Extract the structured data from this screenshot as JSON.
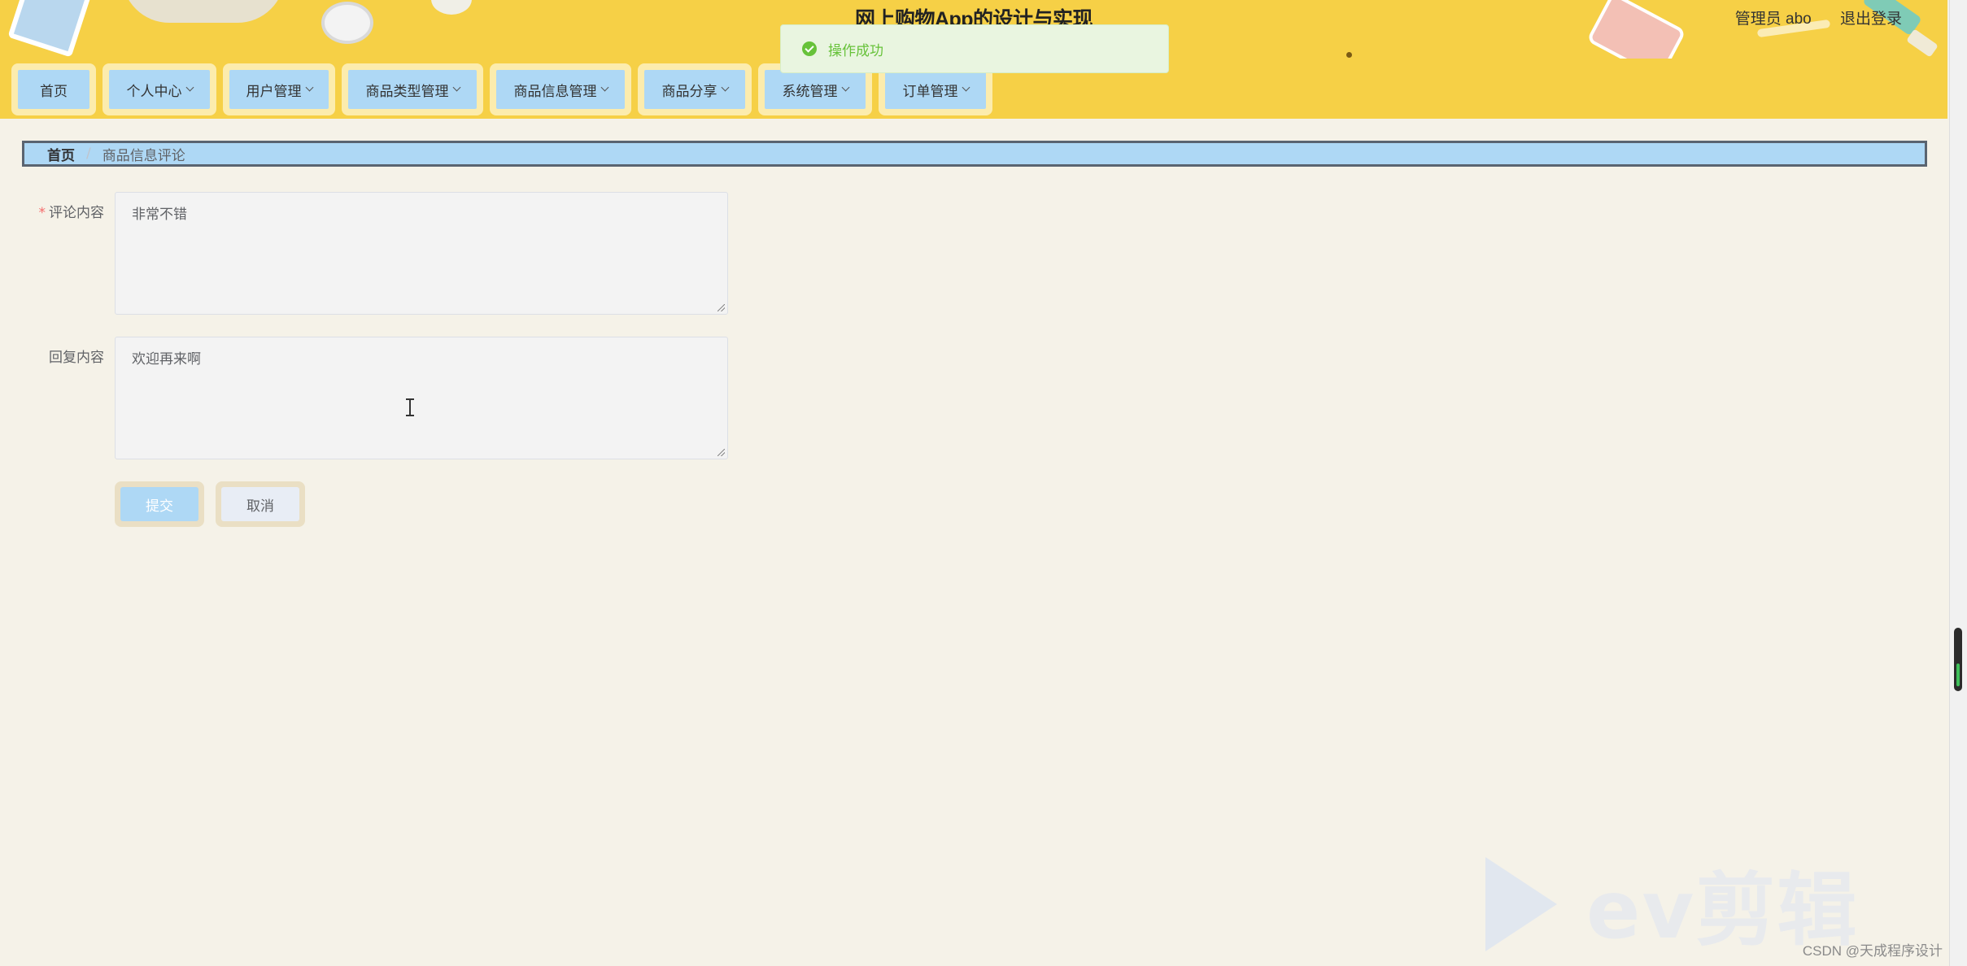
{
  "header": {
    "title": "网上购物App的设计与实现",
    "user": "管理员 abo",
    "logout": "退出登录"
  },
  "nav": {
    "items": [
      {
        "label": "首页",
        "dropdown": false
      },
      {
        "label": "个人中心",
        "dropdown": true
      },
      {
        "label": "用户管理",
        "dropdown": true
      },
      {
        "label": "商品类型管理",
        "dropdown": true
      },
      {
        "label": "商品信息管理",
        "dropdown": true
      },
      {
        "label": "商品分享",
        "dropdown": true
      },
      {
        "label": "系统管理",
        "dropdown": true
      },
      {
        "label": "订单管理",
        "dropdown": true
      }
    ]
  },
  "toast": {
    "message": "操作成功",
    "icon": "success-check-icon",
    "color": "#67c23a"
  },
  "breadcrumb": {
    "home": "首页",
    "separator": "/",
    "current": "商品信息评论"
  },
  "form": {
    "comment": {
      "label": "评论内容",
      "required_mark": "*",
      "value": "非常不错"
    },
    "reply": {
      "label": "回复内容",
      "value": "欢迎再来啊"
    },
    "submit_label": "提交",
    "cancel_label": "取消"
  },
  "watermark": {
    "text": "ev剪辑"
  },
  "credit": "CSDN @天成程序设计"
}
